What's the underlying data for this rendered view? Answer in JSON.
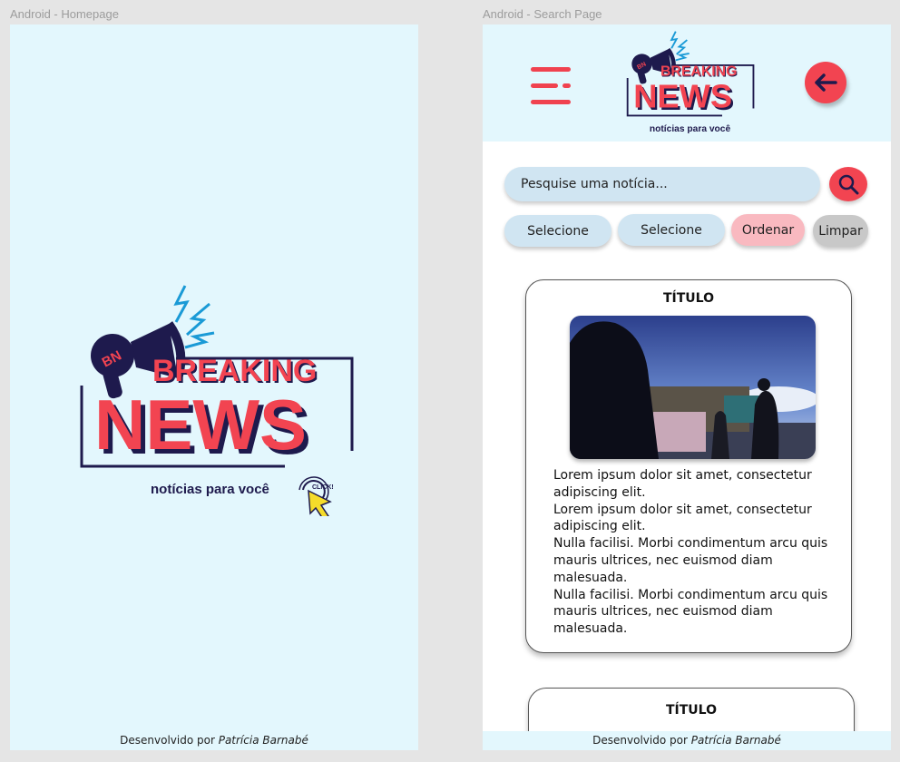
{
  "frames": {
    "home_label": "Android - Homepage",
    "search_label": "Android - Search Page"
  },
  "logo": {
    "badge": "BN",
    "word1": "BREAKING",
    "word2": "NEWS",
    "tagline": "notícias para você",
    "click": "CLICK!"
  },
  "footer": {
    "prefix": "Desenvolvido por ",
    "author": "Patrícia Barnabé"
  },
  "search": {
    "placeholder": "Pesquise uma notícia...",
    "filters": [
      {
        "label": "Selecione",
        "color": "#d0e5f2"
      },
      {
        "label": "Selecione",
        "color": "#d0e5f2"
      },
      {
        "label": "Ordenar",
        "color": "#f9b9c0"
      },
      {
        "label": "Limpar",
        "color": "#c8c8c8"
      }
    ]
  },
  "cards": [
    {
      "title": "TÍTULO",
      "paragraphs": [
        "Lorem ipsum dolor sit amet, consectetur adipiscing elit.",
        "Lorem ipsum dolor sit amet, consectetur adipiscing elit.",
        "Nulla facilisi. Morbi condimentum arcu quis mauris ultrices, nec euismod diam malesuada.",
        "Nulla facilisi. Morbi condimentum arcu quis mauris ultrices, nec euismod diam malesuada."
      ]
    },
    {
      "title": "TÍTULO"
    }
  ],
  "colors": {
    "accent_red": "#f24451",
    "navy": "#1e1a4d",
    "light_blue_bg": "#e3f7fd",
    "lightning": "#1a9ad6"
  },
  "icons": [
    "megaphone-icon",
    "lightning-icon",
    "cursor-click-icon",
    "menu-icon",
    "arrow-left-icon",
    "search-icon"
  ]
}
